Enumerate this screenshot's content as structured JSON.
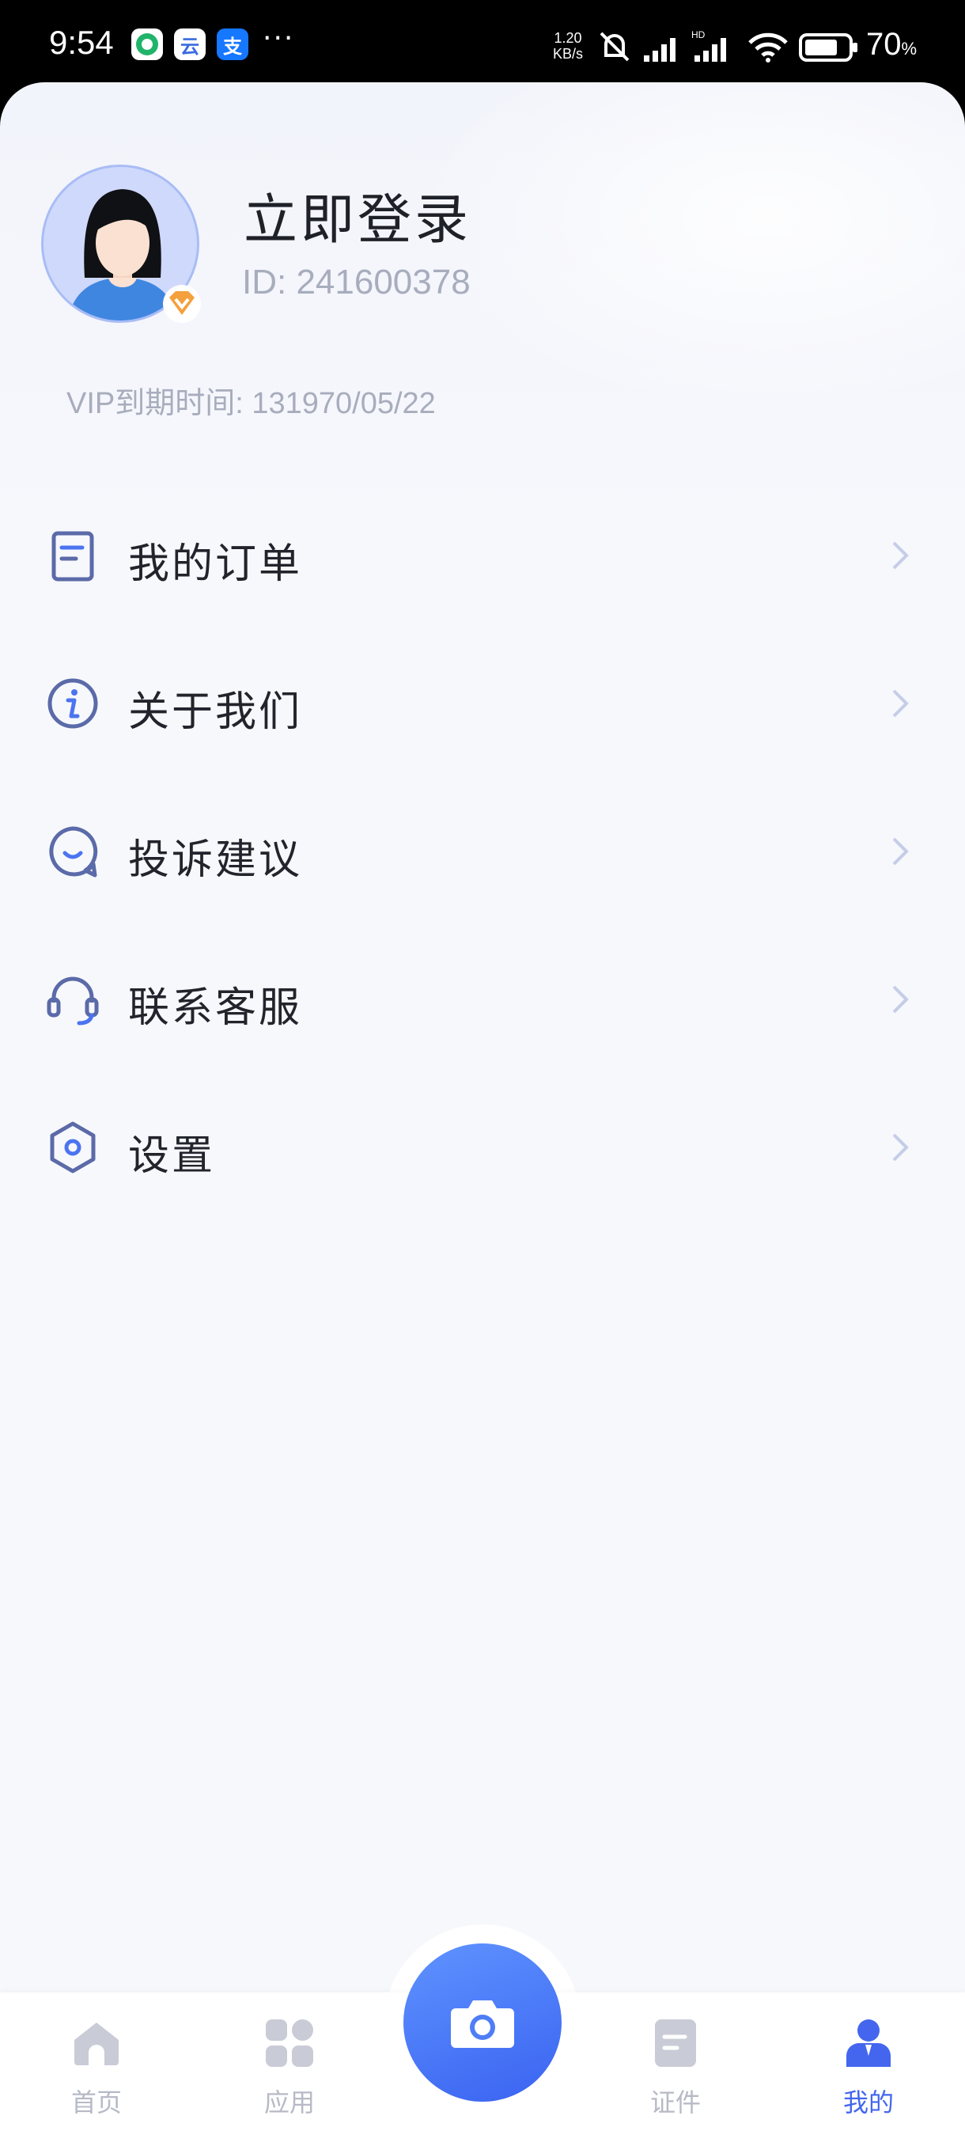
{
  "status_bar": {
    "time": "9:54",
    "apps": [
      {
        "icon": "green-swirl-app-icon",
        "glyph": "S"
      },
      {
        "icon": "cloud-ai-app-icon",
        "glyph": "云"
      },
      {
        "icon": "alipay-app-icon",
        "glyph": "支"
      }
    ],
    "more": "···",
    "net_speed_value": "1.20",
    "net_speed_unit": "KB/s",
    "battery_value": "70",
    "battery_unit": "%"
  },
  "profile": {
    "login_title": "立即登录",
    "user_id": "ID: 241600378",
    "vip_expiry": "VIP到期时间: 131970/05/22"
  },
  "menu": {
    "items": [
      {
        "label": "我的订单",
        "icon": "order-list-icon"
      },
      {
        "label": "关于我们",
        "icon": "info-icon"
      },
      {
        "label": "投诉建议",
        "icon": "feedback-chat-icon"
      },
      {
        "label": "联系客服",
        "icon": "headset-icon"
      },
      {
        "label": "设置",
        "icon": "settings-hexagon-icon"
      }
    ]
  },
  "tabbar": {
    "tabs": [
      {
        "label": "首页",
        "icon": "home-icon",
        "active": false
      },
      {
        "label": "应用",
        "icon": "apps-grid-icon",
        "active": false
      },
      {
        "label": "证件",
        "icon": "document-icon",
        "active": false
      },
      {
        "label": "我的",
        "icon": "profile-icon",
        "active": true
      }
    ],
    "camera_icon": "camera-icon"
  },
  "colors": {
    "accent": "#4466ee",
    "icon_primary": "#5b6aa8",
    "vip_orange": "#f4a03c"
  }
}
